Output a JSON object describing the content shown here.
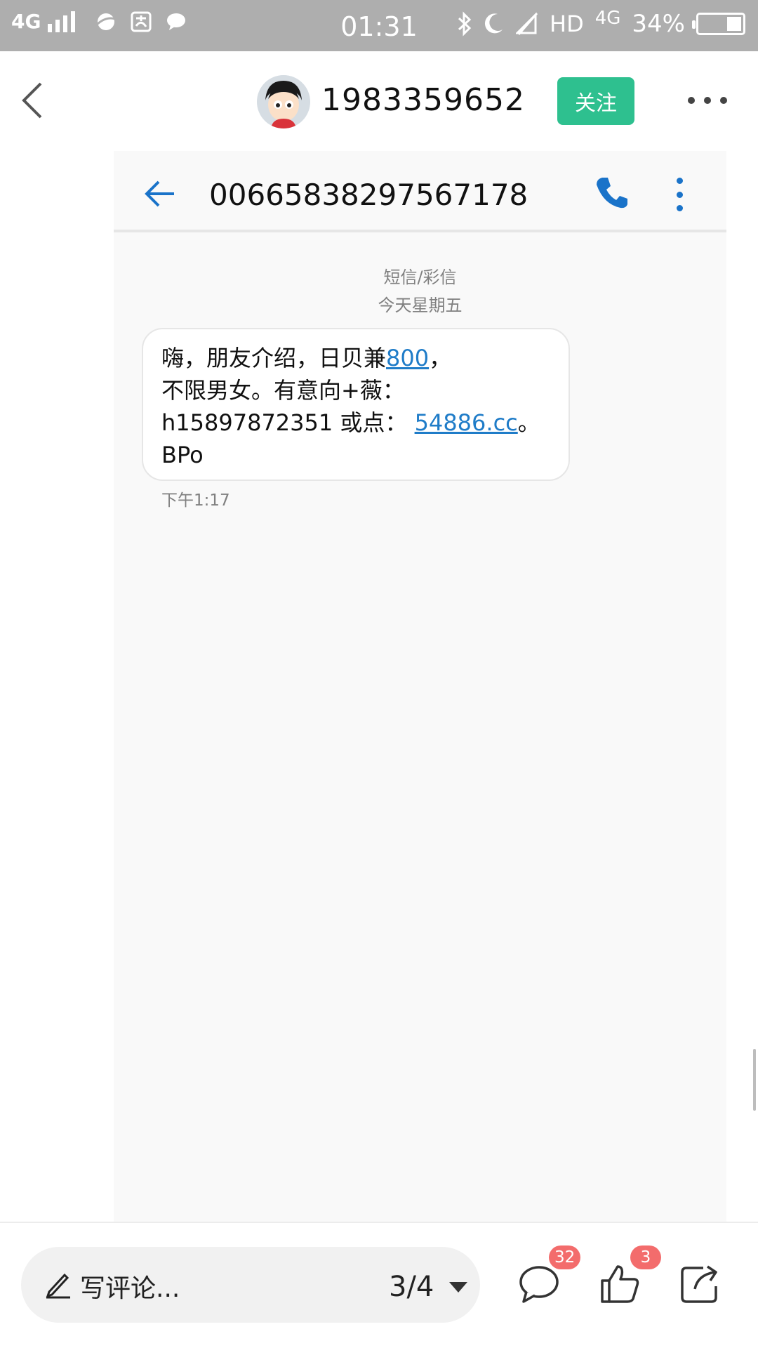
{
  "status_bar": {
    "network": "4G",
    "time": "01:31",
    "hd": "HD",
    "network_right": "4G",
    "battery_percent": "34%",
    "battery_level": 0.34,
    "icons": [
      "signal-icon",
      "planet-app-icon",
      "alipay-icon",
      "chat-bubble-icon",
      "bluetooth-icon",
      "moon-icon",
      "no-signal-icon",
      "battery-icon"
    ]
  },
  "header": {
    "title": "1983359652",
    "follow_label": "关注"
  },
  "sms": {
    "number": "00665838297567178",
    "type_label": "短信/彩信",
    "date_label": "今天星期五",
    "message": {
      "line1_prefix": "嗨，朋友介绍，日贝兼",
      "line1_link": "800",
      "line1_suffix": "，",
      "line2": "不限男女。有意向+薇：",
      "line3_prefix": "h15897872351 或点：",
      "line3_link": "54886.cc",
      "line3_suffix": "。",
      "line4": "BPo"
    },
    "time": "下午1:17"
  },
  "bottom_bar": {
    "comment_placeholder": "写评论...",
    "page_indicator": "3/4",
    "comments_count": "32",
    "likes_count": "3"
  },
  "colors": {
    "status_bar_bg": "#aeaeae",
    "follow_button": "#2ec08f",
    "link": "#1f7cc8",
    "sms_accent": "#1a73c9",
    "badge": "#f36c6c"
  }
}
